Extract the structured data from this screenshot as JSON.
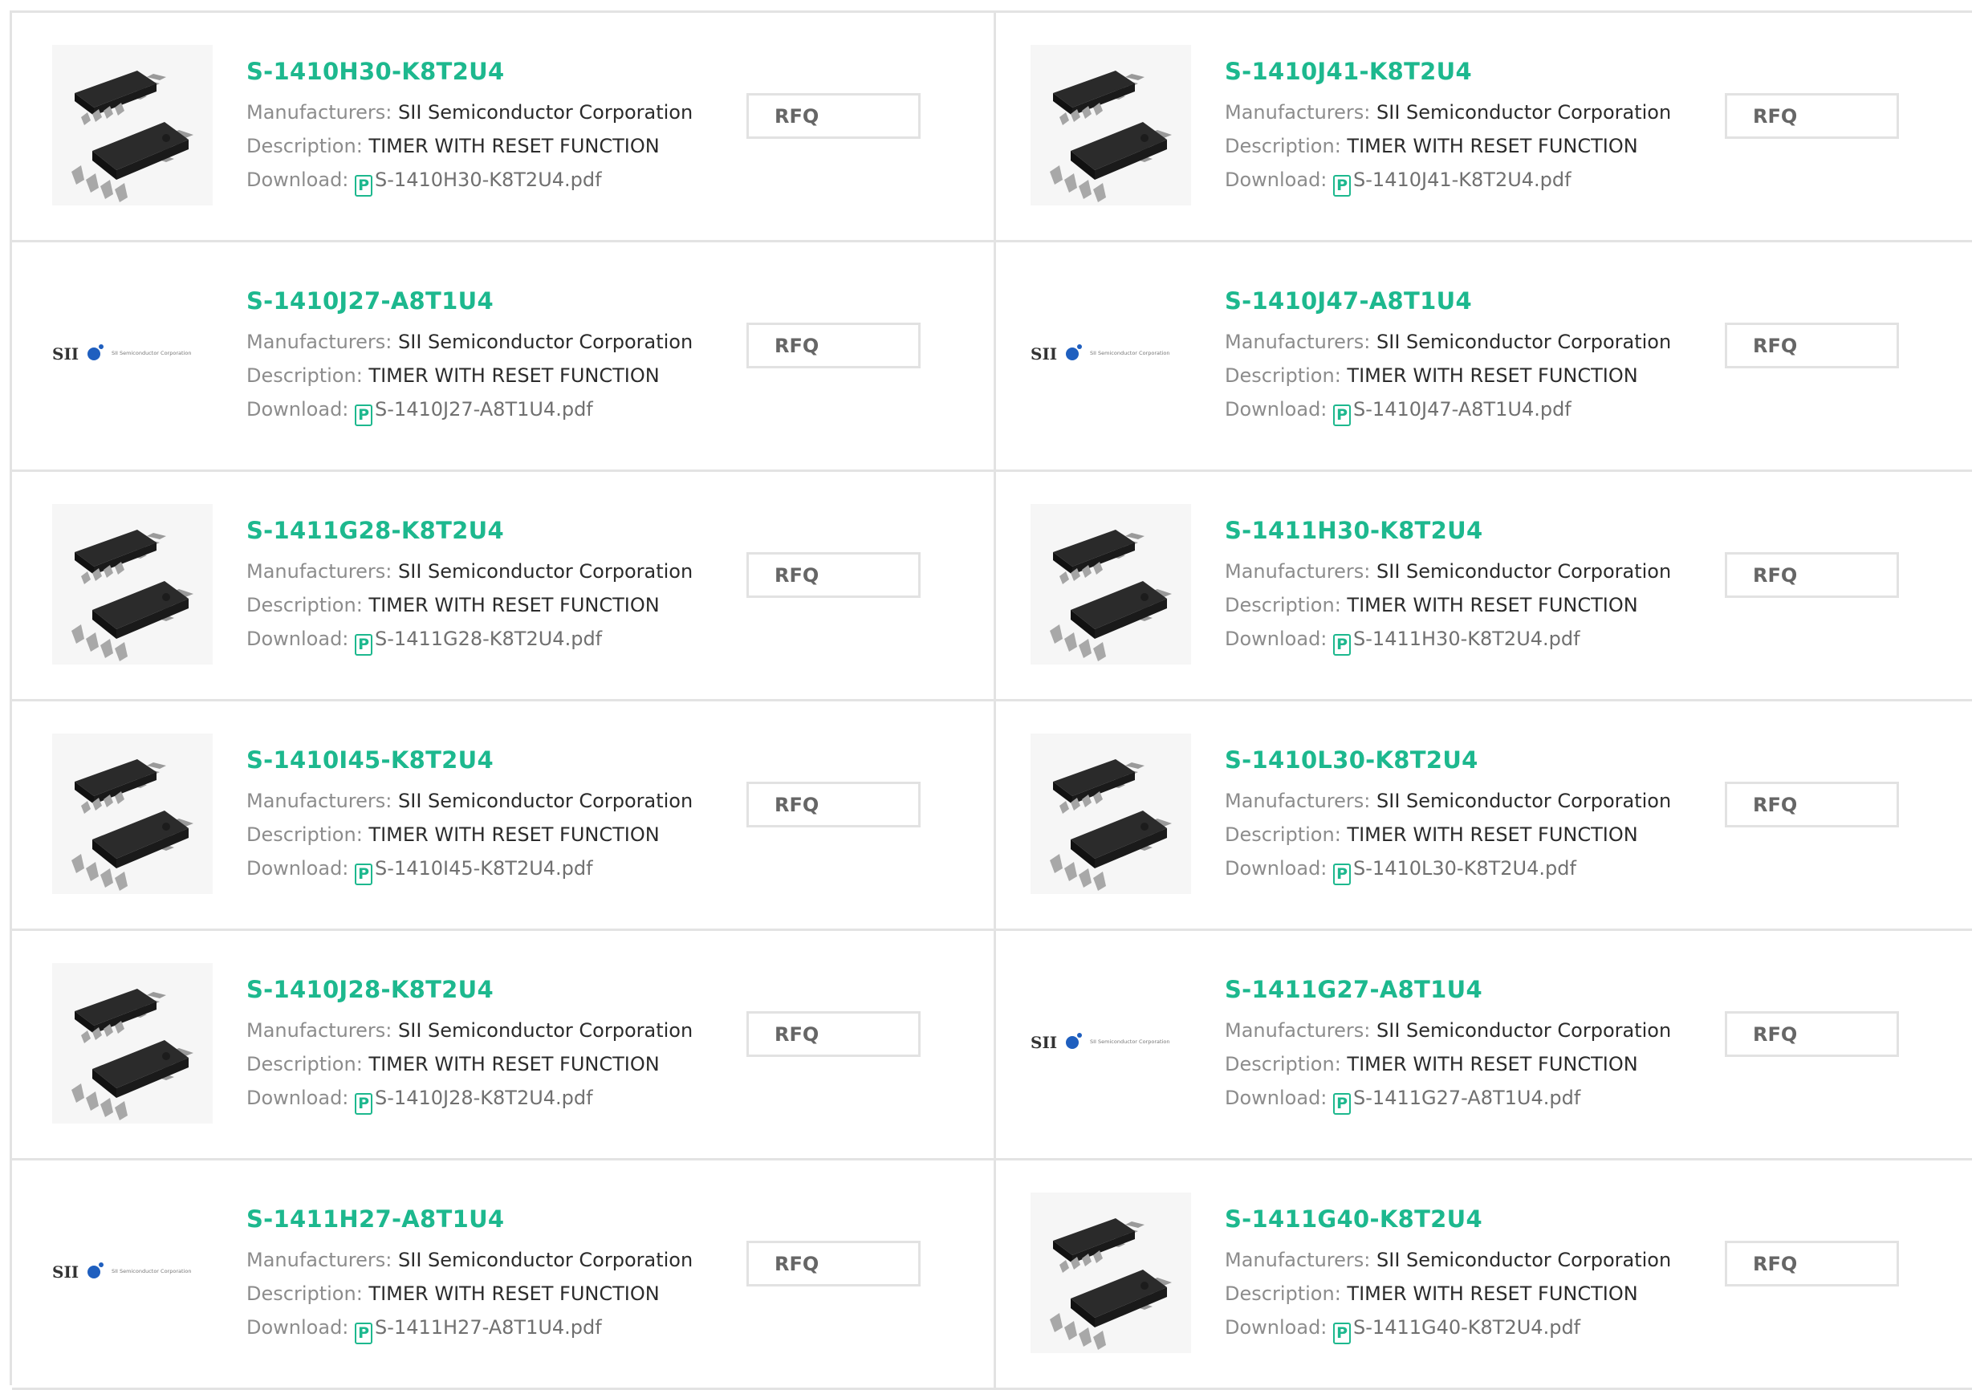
{
  "labels": {
    "manufacturers": "Manufacturers:",
    "description": "Description:",
    "download": "Download:",
    "rfq": "RFQ",
    "pdf_glyph": "P"
  },
  "products": [
    {
      "name": "S-1410H30-K8T2U4",
      "manufacturer": "SII Semiconductor Corporation",
      "description": "TIMER WITH RESET FUNCTION",
      "file": "S-1410H30-K8T2U4.pdf",
      "image": "chip"
    },
    {
      "name": "S-1410J41-K8T2U4",
      "manufacturer": "SII Semiconductor Corporation",
      "description": "TIMER WITH RESET FUNCTION",
      "file": "S-1410J41-K8T2U4.pdf",
      "image": "chip"
    },
    {
      "name": "S-1410J27-A8T1U4",
      "manufacturer": "SII Semiconductor Corporation",
      "description": "TIMER WITH RESET FUNCTION",
      "file": "S-1410J27-A8T1U4.pdf",
      "image": "logo"
    },
    {
      "name": "S-1410J47-A8T1U4",
      "manufacturer": "SII Semiconductor Corporation",
      "description": "TIMER WITH RESET FUNCTION",
      "file": "S-1410J47-A8T1U4.pdf",
      "image": "logo"
    },
    {
      "name": "S-1411G28-K8T2U4",
      "manufacturer": "SII Semiconductor Corporation",
      "description": "TIMER WITH RESET FUNCTION",
      "file": "S-1411G28-K8T2U4.pdf",
      "image": "chip"
    },
    {
      "name": "S-1411H30-K8T2U4",
      "manufacturer": "SII Semiconductor Corporation",
      "description": "TIMER WITH RESET FUNCTION",
      "file": "S-1411H30-K8T2U4.pdf",
      "image": "chip"
    },
    {
      "name": "S-1410I45-K8T2U4",
      "manufacturer": "SII Semiconductor Corporation",
      "description": "TIMER WITH RESET FUNCTION",
      "file": "S-1410I45-K8T2U4.pdf",
      "image": "chip"
    },
    {
      "name": "S-1410L30-K8T2U4",
      "manufacturer": "SII Semiconductor Corporation",
      "description": "TIMER WITH RESET FUNCTION",
      "file": "S-1410L30-K8T2U4.pdf",
      "image": "chip"
    },
    {
      "name": "S-1410J28-K8T2U4",
      "manufacturer": "SII Semiconductor Corporation",
      "description": "TIMER WITH RESET FUNCTION",
      "file": "S-1410J28-K8T2U4.pdf",
      "image": "chip"
    },
    {
      "name": "S-1411G27-A8T1U4",
      "manufacturer": "SII Semiconductor Corporation",
      "description": "TIMER WITH RESET FUNCTION",
      "file": "S-1411G27-A8T1U4.pdf",
      "image": "logo"
    },
    {
      "name": "S-1411H27-A8T1U4",
      "manufacturer": "SII Semiconductor Corporation",
      "description": "TIMER WITH RESET FUNCTION",
      "file": "S-1411H27-A8T1U4.pdf",
      "image": "logo"
    },
    {
      "name": "S-1411G40-K8T2U4",
      "manufacturer": "SII Semiconductor Corporation",
      "description": "TIMER WITH RESET FUNCTION",
      "file": "S-1411G40-K8T2U4.pdf",
      "image": "chip"
    }
  ],
  "logo": {
    "text": "SII",
    "subtext": "SII Semiconductor Corporation"
  },
  "colors": {
    "accent": "#1db88e",
    "border": "#e3e3e3",
    "label": "#8c8c8c",
    "logo_blue": "#1f5fbf"
  }
}
